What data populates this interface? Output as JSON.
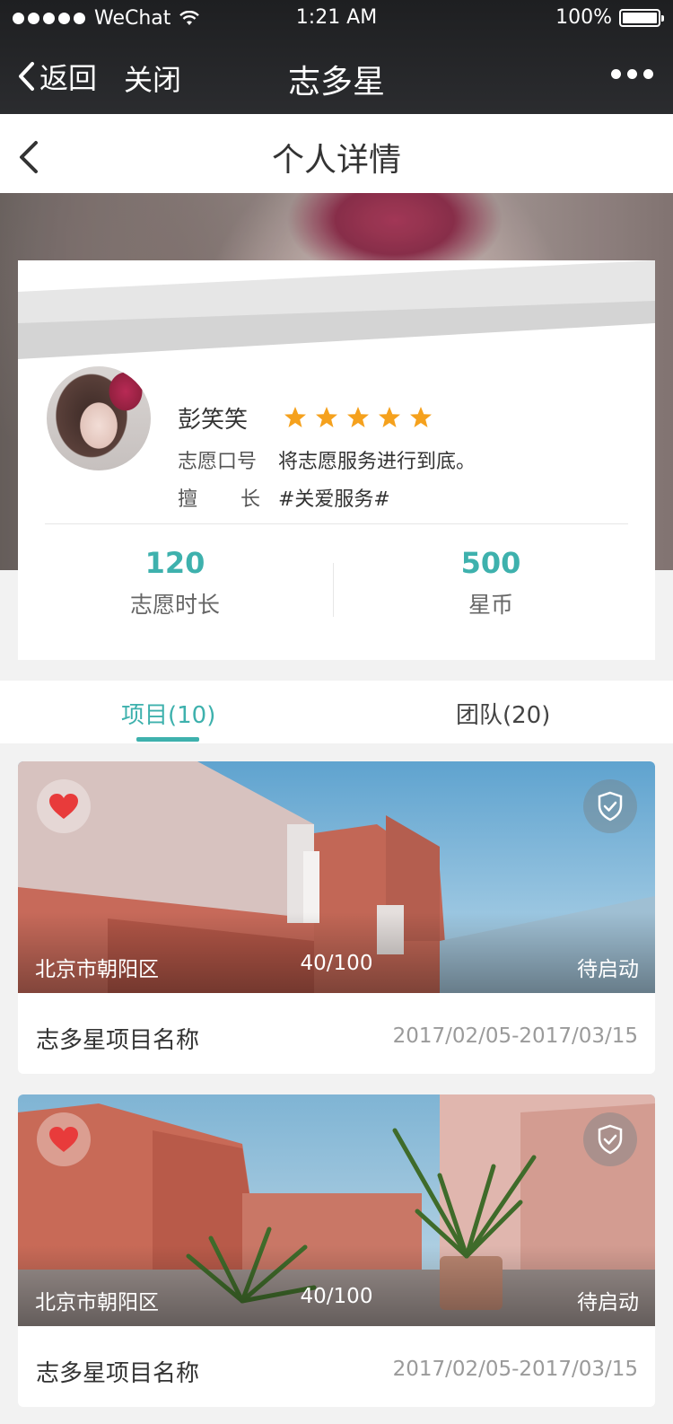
{
  "status_bar": {
    "carrier": "WeChat",
    "time": "1:21 AM",
    "battery": "100%",
    "battery_level": 1.0
  },
  "wechat_nav": {
    "back_label": "返回",
    "close_label": "关闭",
    "title": "志多星"
  },
  "page_header": {
    "title": "个人详情"
  },
  "profile": {
    "name": "彭笑笑",
    "rating": 5,
    "slogan_label": "志愿口号",
    "slogan_value": "将志愿服务进行到底。",
    "specialty_label_1": "擅",
    "specialty_label_2": "长",
    "specialty_value": "#关爱服务#",
    "stats": [
      {
        "value": "120",
        "label": "志愿时长"
      },
      {
        "value": "500",
        "label": "星币"
      }
    ]
  },
  "tabs": [
    {
      "label": "项目(10)",
      "active": true
    },
    {
      "label": "团队(20)",
      "active": false
    }
  ],
  "projects": [
    {
      "location": "北京市朝阳区",
      "progress": "40/100",
      "status": "待启动",
      "name": "志多星项目名称",
      "date_range": "2017/02/05-2017/03/15"
    },
    {
      "location": "北京市朝阳区",
      "progress": "40/100",
      "status": "待启动",
      "name": "志多星项目名称",
      "date_range": "2017/02/05-2017/03/15"
    }
  ],
  "colors": {
    "accent": "#3eb1ad",
    "star": "#f5a11d",
    "heart": "#e83b3b",
    "nav_bg": "#232427"
  },
  "icons": {
    "nav_back": "chevron-left-icon",
    "more": "more-dots-icon",
    "favorite": "heart-icon",
    "verified": "shield-check-icon",
    "rating": "star-icon"
  }
}
